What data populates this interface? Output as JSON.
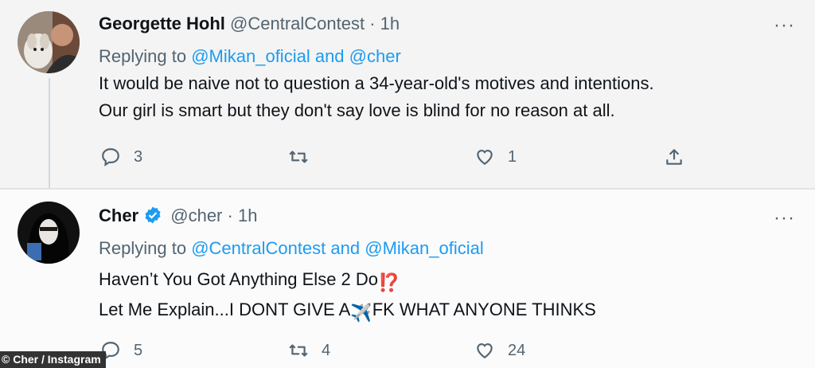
{
  "tweets": [
    {
      "name": "Georgette Hohl",
      "handle": "@CentralContest",
      "time": "· 1h",
      "replying_prefix": "Replying to",
      "replying_user1": "@Mikan_oficial",
      "replying_and": "and",
      "replying_user2": "@cher",
      "text_line1": "It would be naive not to question a 34-year-old's motives and intentions.",
      "text_line2": "Our girl is smart but they don't say love is blind for no reason at all.",
      "reply_count": "3",
      "retweet_count": "",
      "like_count": "1",
      "more": "···"
    },
    {
      "name": "Cher",
      "handle": "@cher",
      "time": "· 1h",
      "replying_prefix": "Replying to",
      "replying_user1": "@CentralContest",
      "replying_and": "and",
      "replying_user2": "@Mikan_oficial",
      "text_line1": "Haven’t You Got Anything Else 2 Do",
      "text_line1_emoji": "⁉️",
      "text_line2_a": "Let Me Explain...I DONT GIVE A",
      "text_line2_emoji": "✈️",
      "text_line2_b": "FK WHAT ANYONE THINKS",
      "reply_count": "5",
      "retweet_count": "4",
      "like_count": "24",
      "more": "···"
    }
  ],
  "icons": {
    "reply": "reply-icon",
    "retweet": "retweet-icon",
    "like": "like-icon",
    "share": "share-icon",
    "verified": "verified-badge-icon"
  },
  "colors": {
    "link": "#1d9bf0",
    "verified": "#1d9bf0",
    "muted": "#536471"
  },
  "watermark": "© Cher / Instagram"
}
